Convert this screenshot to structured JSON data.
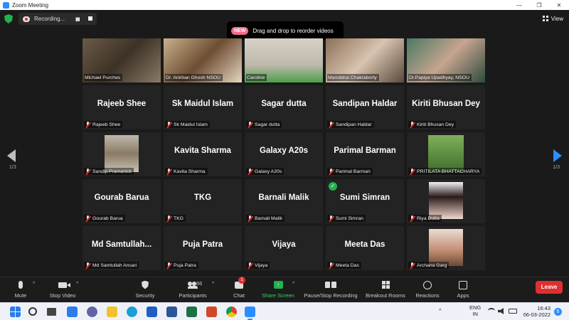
{
  "window": {
    "title": "Zoom Meeting",
    "minimize": "—",
    "maximize": "❐",
    "close": "✕"
  },
  "topbar": {
    "recording_label": "Recording...",
    "view_label": "View"
  },
  "tooltip": {
    "badge": "NEW",
    "text": "Drag and drop to reorder videos"
  },
  "pagination": {
    "left": "1/3",
    "right": "1/3"
  },
  "participants": [
    {
      "name": "Michael Purches",
      "big": "",
      "video": true,
      "speaking": true
    },
    {
      "name": "Dr. Anirban Ghosh NSOU",
      "big": "",
      "video": true
    },
    {
      "name": "Caroline",
      "big": "",
      "video": true
    },
    {
      "name": "Manobina Chakraborty",
      "big": "",
      "video": true
    },
    {
      "name": "Dr.Papiya Upadhyay, NSOU",
      "big": "",
      "video": true
    },
    {
      "name": "Rajeeb Shee",
      "big": "Rajeeb Shee"
    },
    {
      "name": "Sk Maidul Islam",
      "big": "Sk Maidul Islam"
    },
    {
      "name": "Sagar dutta",
      "big": "Sagar dutta"
    },
    {
      "name": "Sandipan Haldar",
      "big": "Sandipan Haldar"
    },
    {
      "name": "Kiriti Bhusan Dey",
      "big": "Kiriti Bhusan Dey"
    },
    {
      "name": "Sandip Pramanick",
      "big": "",
      "photo": true
    },
    {
      "name": "Kavita Sharma",
      "big": "Kavita Sharma"
    },
    {
      "name": "Galaxy A20s",
      "big": "Galaxy A20s"
    },
    {
      "name": "Parimal Barman",
      "big": "Parimal Barman"
    },
    {
      "name": "PRITILATA BHATTACHARYA",
      "big": "",
      "photo": true
    },
    {
      "name": "Gourab Barua",
      "big": "Gourab Barua"
    },
    {
      "name": "TKG",
      "big": "TKG"
    },
    {
      "name": "Barnali Malik",
      "big": "Barnali Malik"
    },
    {
      "name": "Sumi Simran",
      "big": "Sumi Simran",
      "check": true
    },
    {
      "name": "Riya Dutta",
      "big": "",
      "photo": true
    },
    {
      "name": "Md Samtullah Ansari",
      "big": "Md  Samtullah..."
    },
    {
      "name": "Puja Patra",
      "big": "Puja Patra"
    },
    {
      "name": "Vijaya",
      "big": "Vijaya"
    },
    {
      "name": "Meeta Das",
      "big": "Meeta Das"
    },
    {
      "name": "Archana Garg",
      "big": "",
      "photo": true
    }
  ],
  "toolbar": {
    "mute": "Mute",
    "stop_video": "Stop Video",
    "security": "Security",
    "participants": "Participants",
    "participants_count": "66",
    "chat": "Chat",
    "chat_badge": "1",
    "share_screen": "Share Screen",
    "pause_stop_recording": "Pause/Stop Recording",
    "breakout_rooms": "Breakout Rooms",
    "reactions": "Reactions",
    "apps": "Apps",
    "leave": "Leave"
  },
  "taskbar": {
    "lang_top": "ENG",
    "lang_bottom": "IN",
    "time": "16:43",
    "date": "06-03-2022",
    "notification_count": "6",
    "tray_caret": "^"
  },
  "colors": {
    "accent": "#2d8cff",
    "recording_red": "#e02f2f",
    "share_green": "#23b14d",
    "speaker_outline": "#f3e63a"
  }
}
